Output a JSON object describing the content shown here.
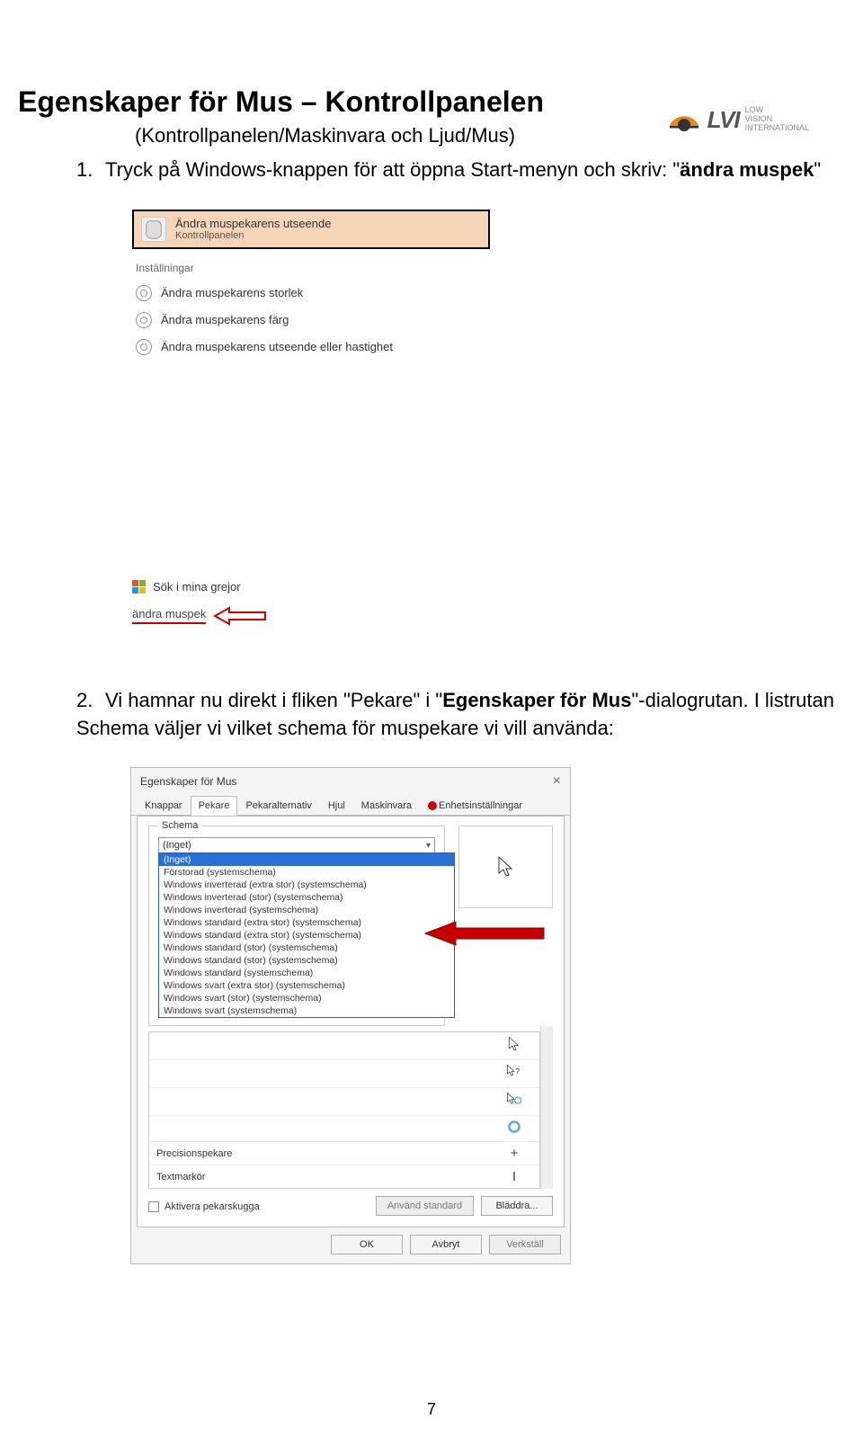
{
  "logo": {
    "brand": "LVI",
    "tagline1": "LOW",
    "tagline2": "VISION",
    "tagline3": "INTERNATIONAL"
  },
  "heading": "Egenskaper för Mus – Kontrollpanelen",
  "subtitle": "(Kontrollpanelen/Maskinvara och Ljud/Mus)",
  "step1": {
    "num": "1.",
    "text_a": "Tryck på Windows-knappen för att öppna Start-menyn och skriv: \"",
    "bold": "ändra muspek",
    "text_b": "\""
  },
  "search_results": {
    "top_title": "Ändra muspekarens utseende",
    "top_sub": "Kontrollpanelen",
    "category": "Inställningar",
    "rows": [
      "Ändra muspekarens storlek",
      "Ändra muspekarens färg",
      "Ändra muspekarens utseende eller hastighet"
    ],
    "footer_label": "Sök i mina grejor",
    "typed": "ändra muspek"
  },
  "step2": {
    "num": "2.",
    "text_a": "Vi hamnar nu direkt i fliken \"Pekare\" i \"",
    "bold": "Egenskaper för Mus",
    "text_b": "\"-dialogrutan. I listrutan Schema väljer vi vilket schema för muspekare vi vill använda:"
  },
  "dialog": {
    "title": "Egenskaper för Mus",
    "tabs": [
      "Knappar",
      "Pekare",
      "Pekaralternativ",
      "Hjul",
      "Maskinvara",
      "Enhetsinställningar"
    ],
    "active_tab": "Pekare",
    "schema_label": "Schema",
    "schema_value": "(Inget)",
    "dropdown_options": [
      "(Inget)",
      "Förstorad (systemschema)",
      "Windows inverterad (extra stor) (systemschema)",
      "Windows inverterad (stor) (systemschema)",
      "Windows inverterad (systemschema)",
      "Windows standard (extra stor) (systemschema)",
      "Windows standard (extra stor) (systemschema)",
      "Windows standard (stor) (systemschema)",
      "Windows standard (stor) (systemschema)",
      "Windows standard (systemschema)",
      "Windows svart (extra stor) (systemschema)",
      "Windows svart (stor) (systemschema)",
      "Windows svart (systemschema)"
    ],
    "dropdown_selected": "(Inget)",
    "cursor_rows": [
      {
        "label": "",
        "sym": "arrow"
      },
      {
        "label": "",
        "sym": "help"
      },
      {
        "label": "",
        "sym": "work"
      },
      {
        "label": "",
        "sym": "busy"
      }
    ],
    "row_precision": "Precisionspekare",
    "row_text": "Textmarkör",
    "checkbox": "Aktivera pekarskugga",
    "btn_default": "Använd standard",
    "btn_browse": "Bläddra...",
    "ok": "OK",
    "cancel": "Avbryt",
    "apply": "Verkställ"
  },
  "page_number": "7"
}
